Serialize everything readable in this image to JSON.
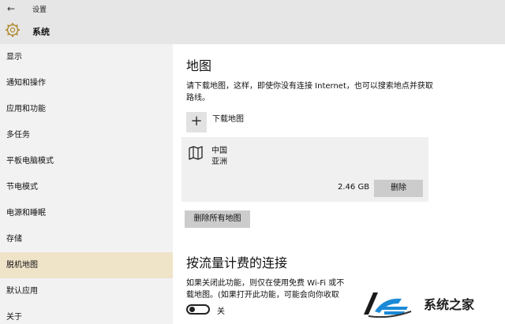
{
  "window": {
    "title": "设置"
  },
  "header": {
    "title": "系统"
  },
  "sidebar": {
    "items": [
      {
        "label": "显示"
      },
      {
        "label": "通知和操作"
      },
      {
        "label": "应用和功能"
      },
      {
        "label": "多任务"
      },
      {
        "label": "平板电脑模式"
      },
      {
        "label": "节电模式"
      },
      {
        "label": "电源和睡眠"
      },
      {
        "label": "存储"
      },
      {
        "label": "脱机地图",
        "active": true
      },
      {
        "label": "默认应用"
      },
      {
        "label": "关于"
      }
    ]
  },
  "maps_section": {
    "title": "地图",
    "description": "请下载地图，这样，即使你没有连接 Internet，也可以搜索地点并获取路线。",
    "download_label": "下载地图",
    "map_item": {
      "name": "中国",
      "region": "亚洲",
      "size": "2.46 GB",
      "delete_label": "删除"
    },
    "delete_all_label": "删除所有地图"
  },
  "metered_section": {
    "title": "按流量计费的连接",
    "description_line1": "如果关闭此功能，则仅在使用免费 Wi-Fi 或不",
    "description_line2": "载地图。(如果打开此功能，可能会向你收取",
    "toggle_state_label": "关"
  },
  "watermark": {
    "text": "系统之家"
  },
  "colors": {
    "sidebar_active": "#efe3c8",
    "chrome": "#e6e6e6"
  }
}
